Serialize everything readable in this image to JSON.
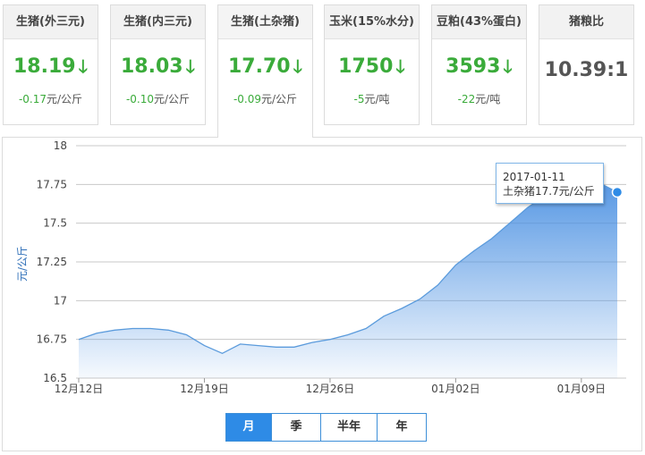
{
  "cards": [
    {
      "title": "生猪(外三元)",
      "value": "18.19",
      "change": "-0.17",
      "unit": "元/公斤",
      "arrow": "down-arrow-icon"
    },
    {
      "title": "生猪(内三元)",
      "value": "18.03",
      "change": "-0.10",
      "unit": "元/公斤",
      "arrow": "down-arrow-icon"
    },
    {
      "title": "生猪(土杂猪)",
      "value": "17.70",
      "change": "-0.09",
      "unit": "元/公斤",
      "arrow": "down-arrow-icon",
      "active": true
    },
    {
      "title": "玉米(15%水分)",
      "value": "1750",
      "change": "-5",
      "unit": "元/吨",
      "arrow": "down-arrow-icon"
    },
    {
      "title": "豆粕(43%蛋白)",
      "value": "3593",
      "change": "-22",
      "unit": "元/吨",
      "arrow": "down-arrow-icon"
    },
    {
      "title": "猪粮比",
      "value": "10.39:1"
    }
  ],
  "colors": {
    "up_down_green": "#3aab3a",
    "accent_blue": "#2e8be6",
    "area_fill": "#6fa8e6"
  },
  "chart_data": {
    "type": "area",
    "ylabel": "元/公斤",
    "ylim": [
      16.5,
      18
    ],
    "yticks": [
      16.5,
      16.75,
      17,
      17.25,
      17.5,
      17.75,
      18
    ],
    "xticks": [
      "12月12日",
      "12月19日",
      "12月26日",
      "01月02日",
      "01月09日"
    ],
    "grid": true,
    "series": [
      {
        "name": "土杂猪",
        "x": [
          "12-12",
          "12-13",
          "12-14",
          "12-15",
          "12-16",
          "12-17",
          "12-18",
          "12-19",
          "12-20",
          "12-21",
          "12-22",
          "12-23",
          "12-24",
          "12-25",
          "12-26",
          "12-27",
          "12-28",
          "12-29",
          "12-30",
          "12-31",
          "01-01",
          "01-02",
          "01-03",
          "01-04",
          "01-05",
          "01-06",
          "01-07",
          "01-08",
          "01-09",
          "01-10",
          "01-11"
        ],
        "values": [
          16.75,
          16.79,
          16.81,
          16.82,
          16.82,
          16.81,
          16.78,
          16.71,
          16.66,
          16.72,
          16.71,
          16.7,
          16.7,
          16.73,
          16.75,
          16.78,
          16.82,
          16.9,
          16.95,
          17.01,
          17.1,
          17.23,
          17.32,
          17.4,
          17.5,
          17.6,
          17.68,
          17.75,
          17.79,
          17.76,
          17.7
        ]
      }
    ],
    "tooltip": {
      "date": "2017-01-11",
      "text": "土杂猪17.7元/公斤"
    }
  },
  "range_tabs": [
    {
      "label": "月",
      "active": true
    },
    {
      "label": "季"
    },
    {
      "label": "半年"
    },
    {
      "label": "年"
    }
  ]
}
